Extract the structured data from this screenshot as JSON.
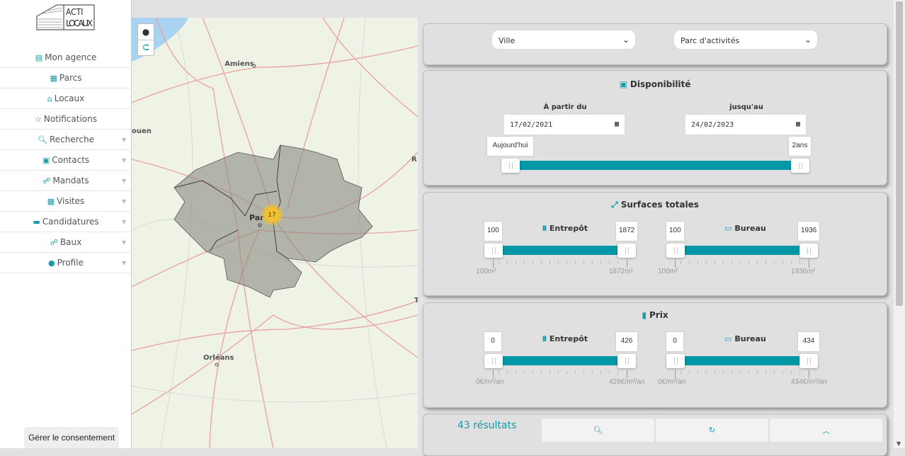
{
  "brand": {
    "logo_text": "ACTI LOCAUX"
  },
  "sidebar": {
    "items": [
      {
        "label": "Mon agence",
        "icon": "store-icon",
        "caret": false
      },
      {
        "label": "Parcs",
        "icon": "buildings-icon",
        "caret": false
      },
      {
        "label": "Locaux",
        "icon": "warehouse-icon",
        "caret": false
      },
      {
        "label": "Notifications",
        "icon": "star-icon",
        "caret": false
      },
      {
        "label": "Recherche",
        "icon": "search-icon",
        "caret": true
      },
      {
        "label": "Contacts",
        "icon": "id-card-icon",
        "caret": true
      },
      {
        "label": "Mandats",
        "icon": "handshake-icon",
        "caret": true
      },
      {
        "label": "Visites",
        "icon": "calendar-icon",
        "caret": true
      },
      {
        "label": "Candidatures",
        "icon": "folder-icon",
        "caret": true
      },
      {
        "label": "Baux",
        "icon": "handshake-icon",
        "caret": true
      },
      {
        "label": "Profile",
        "icon": "user-icon",
        "caret": true
      }
    ],
    "consent": "Gérer le consentement"
  },
  "map": {
    "labels": {
      "amiens": "Amiens",
      "rouen": "ouen",
      "paris": "Par",
      "orleans": "Orléans",
      "reims": "R",
      "troyes": "T"
    },
    "cluster_count": "17",
    "cluster_color": "#f2c12e"
  },
  "filters": {
    "ville": "Ville",
    "parc": "Parc d'activités"
  },
  "disponibilite": {
    "title": "Disponibilité",
    "from_label": "À partir du",
    "to_label": "jusqu'au",
    "from_date": "17/02/2021",
    "to_date": "24/02/2023",
    "min_label": "Aujourd'hui",
    "max_label": "2ans",
    "range": [
      0,
      100
    ]
  },
  "surfaces": {
    "title": "Surfaces totales",
    "entrepot": {
      "label": "Entrepôt",
      "min": "100",
      "max": "1872",
      "scale_min": "100m²",
      "scale_max": "1872m²"
    },
    "bureau": {
      "label": "Bureau",
      "min": "100",
      "max": "1936",
      "scale_min": "100m²",
      "scale_max": "1936m²"
    }
  },
  "prix": {
    "title": "Prix",
    "entrepot": {
      "label": "Entrepôt",
      "min": "0",
      "max": "426",
      "scale_min": "0€/m²/an",
      "scale_max": "426€/m²/an"
    },
    "bureau": {
      "label": "Bureau",
      "min": "0",
      "max": "434",
      "scale_min": "0€/m²/an",
      "scale_max": "434€/m²/an"
    }
  },
  "footer": {
    "results": "43 résultats",
    "buttons": [
      "search-icon",
      "refresh-icon",
      "chevron-up-icon"
    ]
  },
  "colors": {
    "accent": "#0098a6",
    "panel": "#e0e0e0"
  }
}
